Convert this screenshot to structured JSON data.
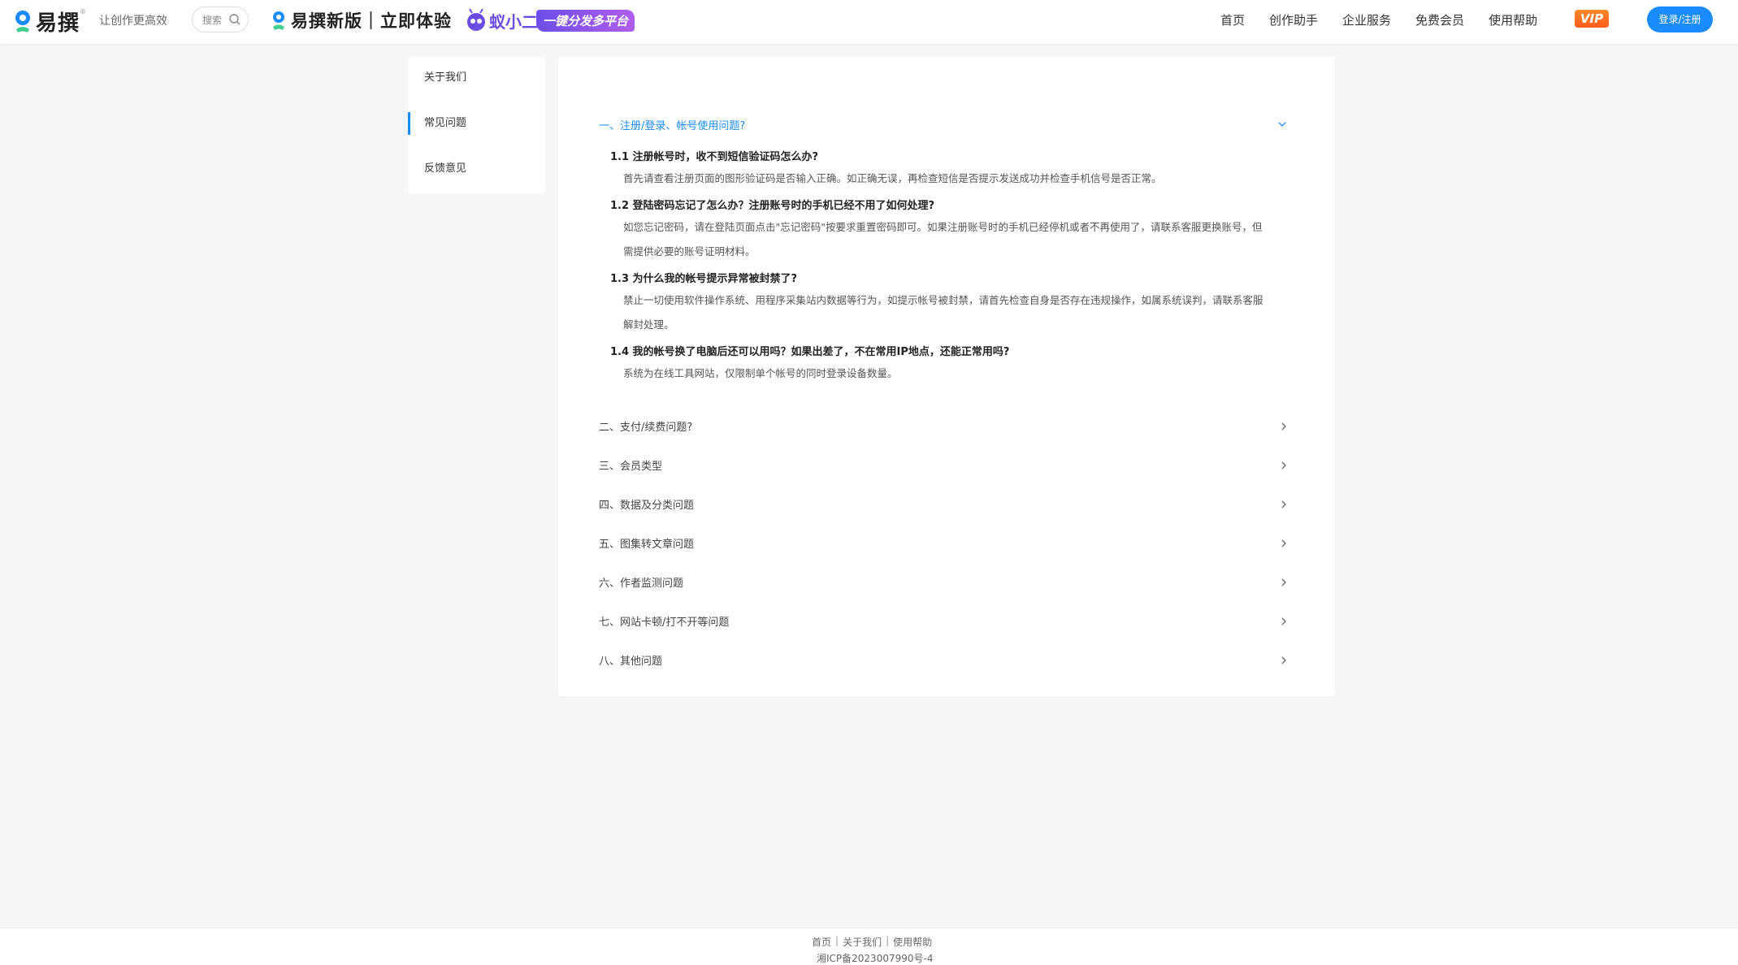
{
  "header": {
    "logo_text": "易撰",
    "logo_reg": "®",
    "slogan": "让创作更高效",
    "search_placeholder": "搜索",
    "promo_new_version": "易撰新版｜立即体验",
    "promo_mascot_name": "蚁小二",
    "promo_badge": "一键分发多平台",
    "nav": [
      "首页",
      "创作助手",
      "企业服务",
      "免费会员",
      "使用帮助"
    ],
    "vip_label": "VIP",
    "login_label": "登录/注册",
    "accent_color": "#1a8cff"
  },
  "sidebar": {
    "items": [
      {
        "label": "关于我们",
        "active": false
      },
      {
        "label": "常见问题",
        "active": true
      },
      {
        "label": "反馈意见",
        "active": false
      }
    ]
  },
  "faq": {
    "open_section": {
      "title": "一、注册/登录、帐号使用问题?",
      "items": [
        {
          "q": "1.1 注册帐号时，收不到短信验证码怎么办?",
          "a_lines": [
            "首先请查看注册页面的图形验证码是否输入正确。如正确无误，再检查短信是否提示发送成功并检查手机信号是否正常。"
          ]
        },
        {
          "q": "1.2 登陆密码忘记了怎么办？注册账号时的手机已经不用了如何处理?",
          "a_lines": [
            "如您忘记密码，请在登陆页面点击\"忘记密码\"按要求重置密码即可。如果注册账号时的手机已经停机或者不再使用了，请联系客服更换账号，但",
            "需提供必要的账号证明材料。"
          ]
        },
        {
          "q": "1.3 为什么我的帐号提示异常被封禁了?",
          "a_lines": [
            "禁止一切使用软件操作系统、用程序采集站内数据等行为，如提示帐号被封禁，请首先检查自身是否存在违规操作，如属系统误判，请联系客服",
            "解封处理。"
          ]
        },
        {
          "q": "1.4 我的帐号换了电脑后还可以用吗？如果出差了，不在常用IP地点，还能正常用吗?",
          "a_lines": [
            "系统为在线工具网站，仅限制单个帐号的同时登录设备数量。"
          ]
        }
      ]
    },
    "sections": [
      "二、支付/续费问题?",
      "三、会员类型",
      "四、数据及分类问题",
      "五、图集转文章问题",
      "六、作者监测问题",
      "七、网站卡顿/打不开等问题",
      "八、其他问题"
    ]
  },
  "footer": {
    "links": [
      "首页",
      "关于我们",
      "使用帮助"
    ],
    "separator": "|",
    "icp": "湘ICP备2023007990号-4"
  }
}
